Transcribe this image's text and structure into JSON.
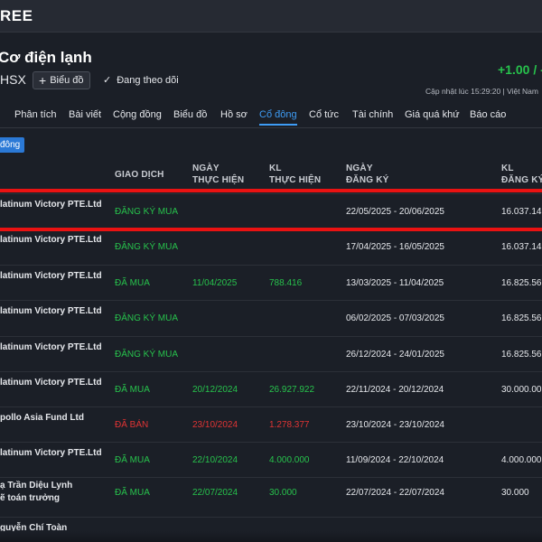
{
  "topbar": {
    "brand": "REE"
  },
  "company": {
    "name": "Cơ điện lạnh",
    "exchange": "HSX",
    "chart_button": "Biểu đồ",
    "follow_label": "Đang theo dõi",
    "price_change": "+1.00 / -",
    "update_text": "Cập nhật lúc   15:29:20 | Việt Nam"
  },
  "tabs": [
    "Phân tích",
    "Bài viết",
    "Cộng đồng",
    "Biểu đồ",
    "Hồ sơ",
    "Cổ đông",
    "Cổ tức",
    "Tài chính",
    "Giá quá khứ",
    "Báo cáo"
  ],
  "active_tab": "Cổ đông",
  "section_badge": "đông",
  "table": {
    "headers": {
      "status": "GIAO DỊCH",
      "exec_date": "NGÀY\nTHỰC HIỆN",
      "qty": "KL\nTHỰC HIỆN",
      "reg_date": "NGÀY\nĐĂNG KÝ",
      "reg_qty": "KL\nĐĂNG KÝ"
    },
    "rows": [
      {
        "name": "latinum Victory PTE.Ltd",
        "status": "ĐĂNG KÝ MUA",
        "type": "buy",
        "exec_date": "",
        "qty": "",
        "reg_date": "22/05/2025 - 20/06/2025",
        "reg_qty": "16.037.14"
      },
      {
        "name": "latinum Victory PTE.Ltd",
        "status": "ĐĂNG KÝ MUA",
        "type": "buy",
        "exec_date": "",
        "qty": "",
        "reg_date": "17/04/2025 - 16/05/2025",
        "reg_qty": "16.037.14"
      },
      {
        "name": "latinum Victory PTE.Ltd",
        "status": "ĐÃ MUA",
        "type": "buy",
        "exec_date": "11/04/2025",
        "qty": "788.416",
        "reg_date": "13/03/2025 - 11/04/2025",
        "reg_qty": "16.825.56"
      },
      {
        "name": "latinum Victory PTE.Ltd",
        "status": "ĐĂNG KÝ MUA",
        "type": "buy",
        "exec_date": "",
        "qty": "",
        "reg_date": "06/02/2025 - 07/03/2025",
        "reg_qty": "16.825.56"
      },
      {
        "name": "latinum Victory PTE.Ltd",
        "status": "ĐĂNG KÝ MUA",
        "type": "buy",
        "exec_date": "",
        "qty": "",
        "reg_date": "26/12/2024 - 24/01/2025",
        "reg_qty": "16.825.56"
      },
      {
        "name": "latinum Victory PTE.Ltd",
        "status": "ĐÃ MUA",
        "type": "buy",
        "exec_date": "20/12/2024",
        "qty": "26.927.922",
        "reg_date": "22/11/2024 - 20/12/2024",
        "reg_qty": "30.000.00"
      },
      {
        "name": "pollo Asia Fund Ltd",
        "status": "ĐÃ BÁN",
        "type": "sell",
        "exec_date": "23/10/2024",
        "qty": "1.278.377",
        "reg_date": "23/10/2024 - 23/10/2024",
        "reg_qty": ""
      },
      {
        "name": "latinum Victory PTE.Ltd",
        "status": "ĐÃ MUA",
        "type": "buy",
        "exec_date": "22/10/2024",
        "qty": "4.000.000",
        "reg_date": "11/09/2024 - 22/10/2024",
        "reg_qty": "4.000.000"
      },
      {
        "name": "ạ Trần Diệu Lynh",
        "name2": "ẽ toán trưởng",
        "status": "ĐÃ MUA",
        "type": "buy",
        "exec_date": "22/07/2024",
        "qty": "30.000",
        "reg_date": "22/07/2024 - 22/07/2024",
        "reg_qty": "30.000"
      },
      {
        "name": "guyễn Chí Toàn",
        "status": "",
        "type": "buy",
        "exec_date": "",
        "qty": "",
        "reg_date": "",
        "reg_qty": ""
      }
    ]
  },
  "colors": {
    "buy": "#27c24c",
    "sell": "#e03434",
    "accent": "#3e9cf5",
    "highlight": "#ea1212"
  }
}
